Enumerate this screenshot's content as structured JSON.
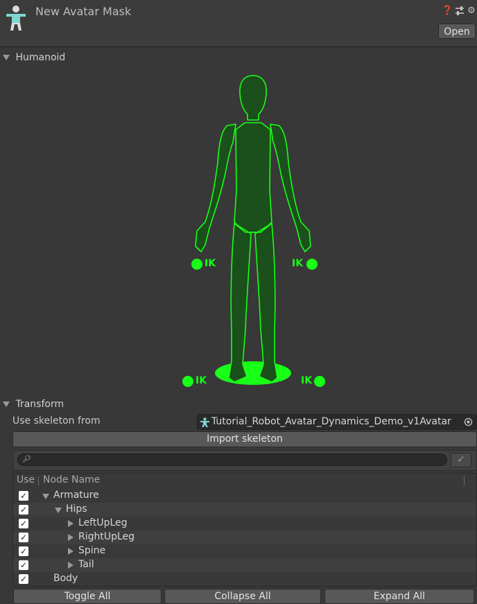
{
  "header": {
    "title": "New Avatar Mask",
    "open_label": "Open",
    "icons": [
      "avatar-mask-icon",
      "help-icon",
      "preset-icon",
      "settings-icon"
    ]
  },
  "humanoid": {
    "section_label": "Humanoid",
    "ik_labels": {
      "left_hand": "IK",
      "right_hand": "IK",
      "left_foot": "IK",
      "right_foot": "IK"
    },
    "accent_color": "#18ff18"
  },
  "transform": {
    "section_label": "Transform",
    "skeleton_label": "Use skeleton from",
    "skeleton_value": "Tutorial_Robot_Avatar_Dynamics_Demo_v1Avatar",
    "import_label": "Import skeleton",
    "search_placeholder": "",
    "columns": {
      "use": "Use",
      "node_name": "Node Name"
    },
    "rows": [
      {
        "name": "Armature",
        "checked": true,
        "indent": 0,
        "expander": "expanded"
      },
      {
        "name": "Hips",
        "checked": true,
        "indent": 1,
        "expander": "expanded"
      },
      {
        "name": "LeftUpLeg",
        "checked": true,
        "indent": 2,
        "expander": "collapsed"
      },
      {
        "name": "RightUpLeg",
        "checked": true,
        "indent": 2,
        "expander": "collapsed"
      },
      {
        "name": "Spine",
        "checked": true,
        "indent": 2,
        "expander": "collapsed"
      },
      {
        "name": "Tail",
        "checked": true,
        "indent": 2,
        "expander": "collapsed"
      },
      {
        "name": "Body",
        "checked": true,
        "indent": 0,
        "expander": "none"
      }
    ],
    "buttons": {
      "toggle_all": "Toggle All",
      "collapse_all": "Collapse All",
      "expand_all": "Expand All"
    }
  }
}
